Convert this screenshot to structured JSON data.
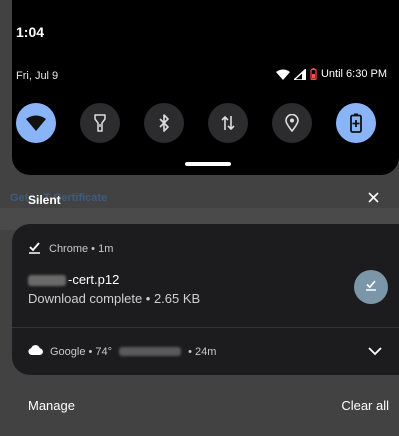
{
  "status_bar": {
    "time": "1:04",
    "date": "Fri, Jul 9",
    "alarm_text": "Until 6:30 PM"
  },
  "quick_settings": {
    "tiles": [
      {
        "name": "wifi",
        "icon": "wifi-icon",
        "state": "on"
      },
      {
        "name": "flashlight",
        "icon": "flashlight-icon",
        "state": "off"
      },
      {
        "name": "bluetooth",
        "icon": "bluetooth-icon",
        "state": "off"
      },
      {
        "name": "mobile-data",
        "icon": "data-arrows-icon",
        "state": "off"
      },
      {
        "name": "location",
        "icon": "location-icon",
        "state": "off"
      },
      {
        "name": "battery-saver",
        "icon": "battery-saver-icon",
        "state": "on"
      }
    ],
    "accent_color": "#8ab4f8"
  },
  "background_page": {
    "title": "Get ... T Certificate"
  },
  "notifications": {
    "section_label": "Silent",
    "chrome": {
      "app_line": "Chrome • 1m",
      "file_name_suffix": "-cert.p12",
      "status": "Download complete • 2.65 KB"
    },
    "google": {
      "app_prefix": "Google • 74°",
      "age": "• 24m"
    }
  },
  "footer": {
    "manage_label": "Manage",
    "clear_all_label": "Clear all"
  }
}
